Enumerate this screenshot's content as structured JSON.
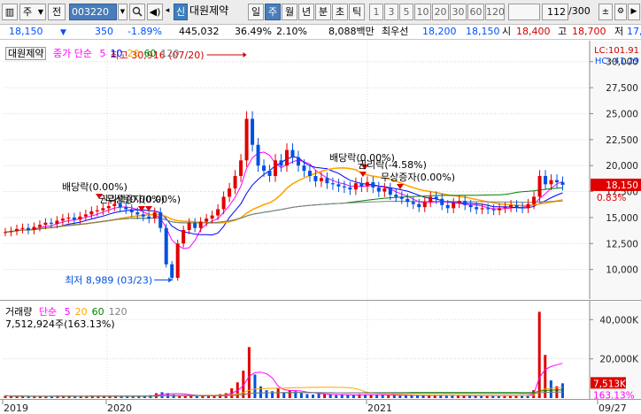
{
  "toolbar": {
    "market": "주",
    "market2": "전",
    "code": "003220",
    "stock_badge": "신",
    "stock_name": "대원제약",
    "periods": [
      "일",
      "주",
      "월",
      "년",
      "분",
      "초",
      "틱"
    ],
    "active_period": "주",
    "intervals": [
      "1",
      "3",
      "5",
      "10",
      "20",
      "30",
      "60",
      "120"
    ],
    "count": "112",
    "total": "/300"
  },
  "quote": {
    "price": "18,150",
    "change": "350",
    "change_pct": "-1.89%",
    "volume": "445,032",
    "volume_ratio": "36.49%",
    "turnover_rate": "2.10%",
    "trade_value": "8,088백만",
    "prefer_label": "최우선",
    "ask": "18,200",
    "bid": "18,150",
    "open_label": "시",
    "open": "18,400",
    "high_label": "고",
    "high": "18,700",
    "low_label": "저",
    "low": "17,..."
  },
  "price_pane": {
    "title": "대원제약",
    "ma_label": "종가 단순",
    "ma_periods": [
      "5",
      "10",
      "20",
      "60",
      "120"
    ],
    "ma_colors": [
      "#FF00FF",
      "#0000FF",
      "#FFA500",
      "#008000",
      "#808080"
    ],
    "lc_label": "LC:101.91",
    "hc_label": "HC:-41.29",
    "y_ticks": [
      "30,000",
      "27,500",
      "25,000",
      "22,500",
      "20,000",
      "17,500",
      "15,000",
      "12,500",
      "10,000"
    ],
    "current_price_tag": "18,150",
    "current_pct_tag": "0.83%",
    "high_note": "최고 30,916 (07/20)",
    "low_note": "최저 8,989 (03/23)",
    "annotations": [
      "배당락(0.00%)",
      "권리락(0.00%)",
      "무상증자(0.00%)",
      "배당락(0.00%)",
      "권리락(-4.58%)",
      "무상증자(0.00%)"
    ]
  },
  "volume_pane": {
    "title": "거래량",
    "ma_label": "단순",
    "ma_periods": [
      "5",
      "20",
      "60",
      "120"
    ],
    "ma_colors": [
      "#FF00FF",
      "#FFA500",
      "#008000",
      "#808080"
    ],
    "current_volume": "7,512,924주(163.13%)",
    "y_ticks": [
      "40,000K",
      "20,000K"
    ],
    "current_tag": "7,513K",
    "current_pct_tag": "163.13%"
  },
  "date_axis": {
    "labels": [
      "2019",
      "2020",
      "2021",
      "09/27"
    ]
  },
  "chart_data": {
    "type": "candlestick",
    "period": "weekly",
    "ylim": [
      7500,
      31000
    ],
    "candles_close": [
      13600,
      13700,
      13900,
      14000,
      13800,
      14100,
      14300,
      14500,
      14400,
      14700,
      14900,
      15000,
      14800,
      15100,
      15300,
      15600,
      15700,
      15900,
      16100,
      16300,
      16000,
      15800,
      15500,
      15300,
      15100,
      14900,
      15500,
      14000,
      10500,
      9200,
      12500,
      13800,
      14500,
      14000,
      14600,
      14900,
      15200,
      15800,
      17000,
      17800,
      19000,
      20500,
      24500,
      22000,
      20000,
      19500,
      19000,
      20500,
      20000,
      21500,
      20800,
      20000,
      19500,
      19000,
      18500,
      18800,
      18300,
      18200,
      18000,
      17900,
      17700,
      18300,
      18000,
      18400,
      17900,
      17500,
      17800,
      17200,
      17000,
      16800,
      16500,
      16300,
      16000,
      16500,
      17000,
      16800,
      16200,
      15900,
      16400,
      16600,
      16200,
      16000,
      15800,
      15900,
      15800,
      15700,
      15900,
      16000,
      16200,
      16000,
      15900,
      16300,
      17000,
      19000,
      18200,
      18600,
      18400,
      18150
    ],
    "volume_k": [
      1200,
      900,
      1100,
      800,
      700,
      1000,
      900,
      850,
      1100,
      1200,
      900,
      1000,
      800,
      900,
      1100,
      1300,
      1000,
      900,
      1000,
      1100,
      800,
      900,
      1000,
      1200,
      900,
      1500,
      2500,
      3000,
      2500,
      1800,
      1500,
      1400,
      1200,
      1000,
      1100,
      1300,
      1500,
      2000,
      2500,
      5000,
      8000,
      14000,
      26000,
      12000,
      6000,
      4000,
      3500,
      5000,
      3000,
      4000,
      3500,
      2500,
      2000,
      1800,
      2200,
      2000,
      1800,
      1500,
      1600,
      1500,
      1400,
      2000,
      1800,
      1700,
      1600,
      1500,
      1400,
      1400,
      1300,
      1500,
      1400,
      1300,
      1300,
      1600,
      1500,
      1400,
      1200,
      1300,
      1400,
      1200,
      1300,
      1200,
      1100,
      1300,
      1100,
      1200,
      1300,
      1400,
      1200,
      1500,
      1300,
      4000,
      44000,
      22000,
      9000,
      6000,
      7513
    ]
  }
}
